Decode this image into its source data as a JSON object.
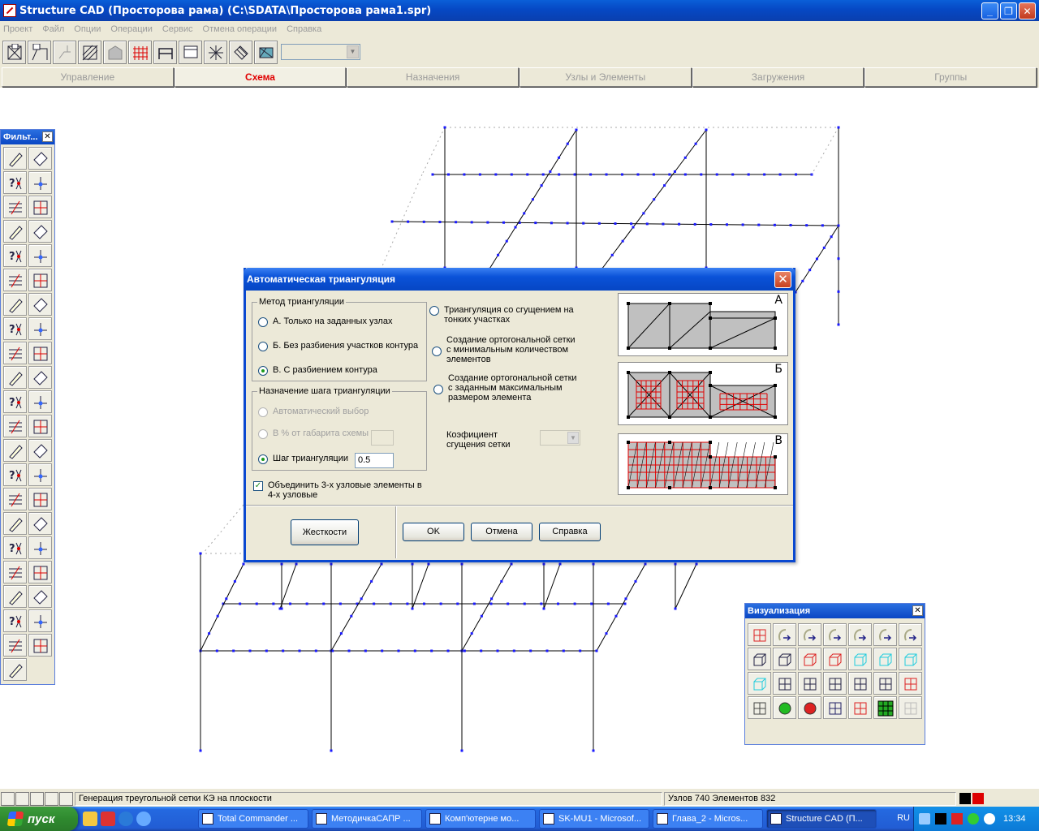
{
  "window": {
    "title": "Structure CAD (Просторова рама) (C:\\SDATA\\Просторова рама1.spr)",
    "min_label": "_",
    "max_label": "❐",
    "close_label": "✕"
  },
  "menu": [
    "Проект",
    "Файл",
    "Опции",
    "Операции",
    "Сервис",
    "Отмена операции",
    "Справка"
  ],
  "tabs": [
    {
      "label": "Управление",
      "active": false
    },
    {
      "label": "Схема",
      "active": true
    },
    {
      "label": "Назначения",
      "active": false
    },
    {
      "label": "Узлы и Элементы",
      "active": false
    },
    {
      "label": "Загружения",
      "active": false
    },
    {
      "label": "Группы",
      "active": false
    }
  ],
  "filter_panel": {
    "title": "Фильт...",
    "close_label": "✕"
  },
  "viz_panel": {
    "title": "Визуализация",
    "close_label": "✕"
  },
  "dialog": {
    "title": "Автоматическая триангуляция",
    "close_label": "✕",
    "method_group": "Метод триангуляции",
    "method_a": "А. Только на заданных узлах",
    "method_b": "Б. Без разбиения участков контура",
    "method_c": "В. С разбиением контура",
    "step_group": "Назначение шага триангуляции",
    "step_auto": "Автоматический выбор",
    "step_percent": "В % от габарита схемы",
    "step_value_label": "Шаг триангуляции",
    "step_value": "0.5",
    "merge_check": "Объединить 3-х узловые элементы в 4-х узловые",
    "opt_dense": "Триангуляция со сгущением на тонких участках",
    "opt_ortho_min": "Создание ортогональной сетки с минимальным количеством элементов",
    "opt_ortho_max": "Создание ортогональной сетки с заданным максимальным размером элемента",
    "coef_label": "Коэфициент сгущения сетки",
    "btn_stiffness": "Жесткости",
    "btn_ok": "OK",
    "btn_cancel": "Отмена",
    "btn_help": "Справка",
    "preview_a": "А",
    "preview_b": "Б",
    "preview_c": "В",
    "colors": {
      "mesh_fill": "#c0c0c0",
      "mesh_line": "#e00000"
    }
  },
  "status": {
    "message": "Генерация треугольной сетки КЭ на плоскости",
    "counts": "Узлов 740 Элементов 832"
  },
  "taskbar": {
    "start": "пуск",
    "tasks": [
      {
        "label": "Total Commander ...",
        "active": false
      },
      {
        "label": "МетодичкаСАПР ...",
        "active": false
      },
      {
        "label": "Комп'ютерне мо...",
        "active": false
      },
      {
        "label": "SK-MU1 - Microsof...",
        "active": false
      },
      {
        "label": "Глава_2 - Micros...",
        "active": false
      },
      {
        "label": "Structure CAD (П...",
        "active": true
      }
    ],
    "lang": "RU",
    "clock": "13:34"
  },
  "colors": {
    "node": "#1a1aff",
    "accent": "#0a48d0",
    "active_tab": "#e00000"
  }
}
